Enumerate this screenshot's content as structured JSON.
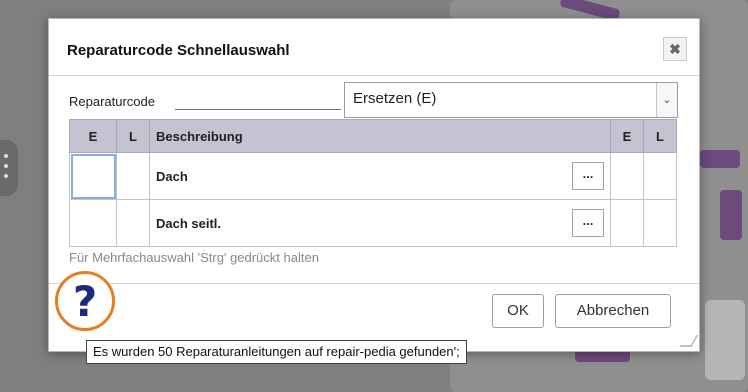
{
  "dialog": {
    "title": "Reparaturcode Schnellauswahl",
    "close_symbol": "✖",
    "repair_code_label": "Reparaturcode",
    "repair_code_value": "Ersetzen (E)",
    "table": {
      "headers": [
        "E",
        "L",
        "Beschreibung",
        "E",
        "L"
      ],
      "rows": [
        {
          "description": "Dach",
          "action": "..."
        },
        {
          "description": "Dach seitl.",
          "action": "..."
        }
      ]
    },
    "hint": "Für Mehrfachauswahl 'Strg' gedrückt halten",
    "ok_label": "OK",
    "cancel_label": "Abbrechen"
  },
  "help_icon": "question-mark",
  "help_symbol": "?",
  "tooltip": "Es wurden 50 Reparaturanleitungen auf repair-pedia gefunden';",
  "colors": {
    "header_bg": "#c3c3d2",
    "help_ring": "#e67e22",
    "help_mark": "#1a2c7a"
  }
}
